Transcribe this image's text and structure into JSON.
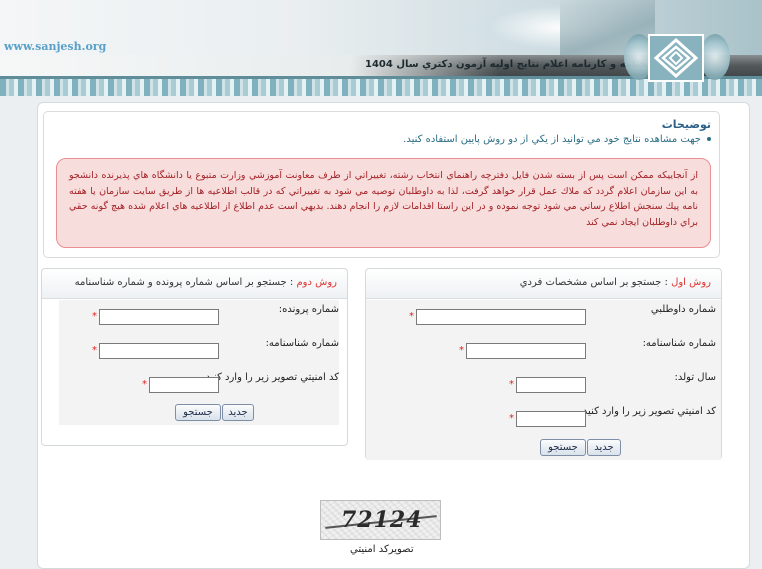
{
  "header": {
    "site_url": "www.sanjesh.org",
    "title": "پاسخنامه و کارنامه اعلام نتايج اوليه آزمون دكتري سال 1404",
    "logo_icon": "sanjesh-logo-icon"
  },
  "description": {
    "title": "توضيحات",
    "bullet": "جهت مشاهده نتايج خود مي توانيد از يكي از دو روش پايين استفاده كنيد.",
    "notice": "از آنجاييكه ممکن است پس از بسته شدن فايل دفترچه راهنماي انتخاب رشته، تغييراتي از طرف معاونت آموزشي وزارت متبوع يا دانشگاه هاي پذيرنده دانشجو به اين سازمان اعلام گردد كه ملاك عمل قرار خواهد گرفت، لذا به داوطلبان توصيه مي شود به تغييراتي كه در قالب اطلاعيه ها از طريق سايت سازمان يا هفته نامه پيك سنجش اطلاع رساني مي شود توجه نموده و در اين راستا اقدامات لازم را انجام دهند. بديهي است عدم اطلاع از اطلاعيه هاي اعلام شده هيچ گونه حقي براي داوطلبان ايجاد نمي كند"
  },
  "method1": {
    "method_label": "روش اول",
    "separator": " : ",
    "heading": "جستجو بر اساس مشخصات فردي",
    "applicant_number_label": "شماره داوطلبي",
    "id_number_label": "شماره شناسنامه:",
    "birth_year_label": "سال تولد:",
    "captcha_label": "كد امنيتي تصوير زير را وارد كنيد",
    "required_mark": "*",
    "search_button": "جستجو",
    "new_button": "جديد",
    "applicant_number_value": "",
    "id_number_value": "",
    "birth_year_value": "",
    "captcha_value": ""
  },
  "method2": {
    "method_label": "روش دوم",
    "separator": " : ",
    "heading": "جستجو بر اساس شماره پرونده و شماره شناسنامه",
    "file_number_label": "شماره پرونده:",
    "id_number_label": "شماره شناسنامه:",
    "captcha_label": "كد امنيتي تصوير زير را وارد كنيد",
    "required_mark": "*",
    "search_button": "جستجو",
    "new_button": "جديد",
    "file_number_value": "",
    "id_number_value": "",
    "captcha_value": ""
  },
  "captcha": {
    "code": "72124",
    "label": "تصويركد امنيتي"
  }
}
